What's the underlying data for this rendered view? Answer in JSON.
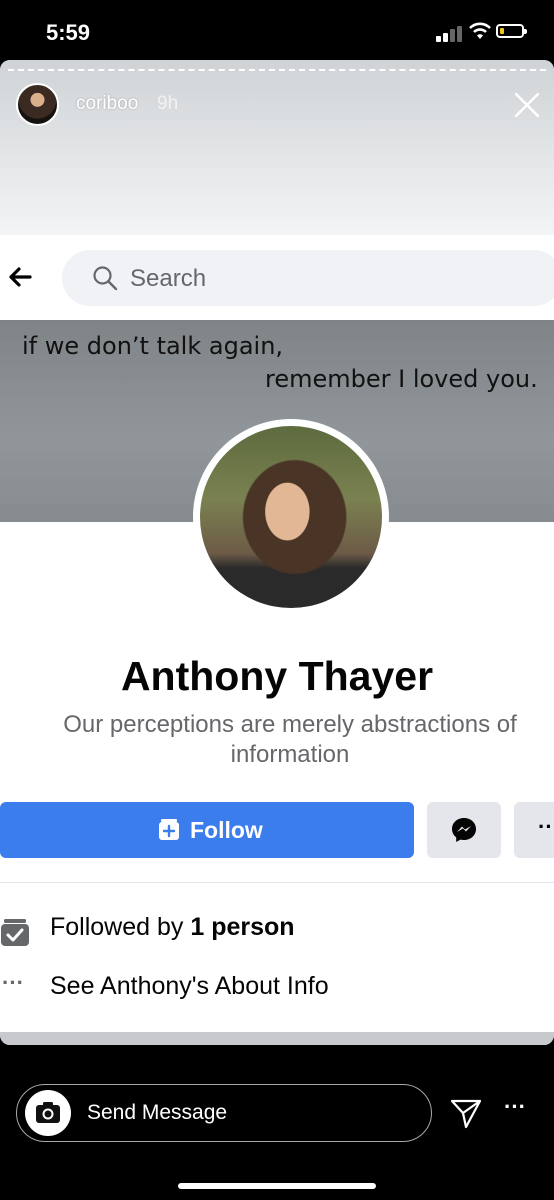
{
  "status_bar": {
    "time": "5:59"
  },
  "story": {
    "username": "coriboo",
    "time_ago": "9h"
  },
  "fb_header": {
    "search_placeholder": "Search"
  },
  "cover": {
    "line1": "if we don’t talk again,",
    "line2": "remember I loved you."
  },
  "profile": {
    "name": "Anthony Thayer",
    "bio": "Our perceptions are merely abstractions of information"
  },
  "actions": {
    "follow_label": "Follow",
    "more_label": "···"
  },
  "info": {
    "followed_prefix": "Followed by ",
    "followed_count": "1 person",
    "about_text": "See Anthony's About Info",
    "about_dots": "···"
  },
  "footer": {
    "send_message": "Send Message",
    "more": "···"
  },
  "colors": {
    "follow_button": "#3b7ded",
    "background": "#000000"
  }
}
